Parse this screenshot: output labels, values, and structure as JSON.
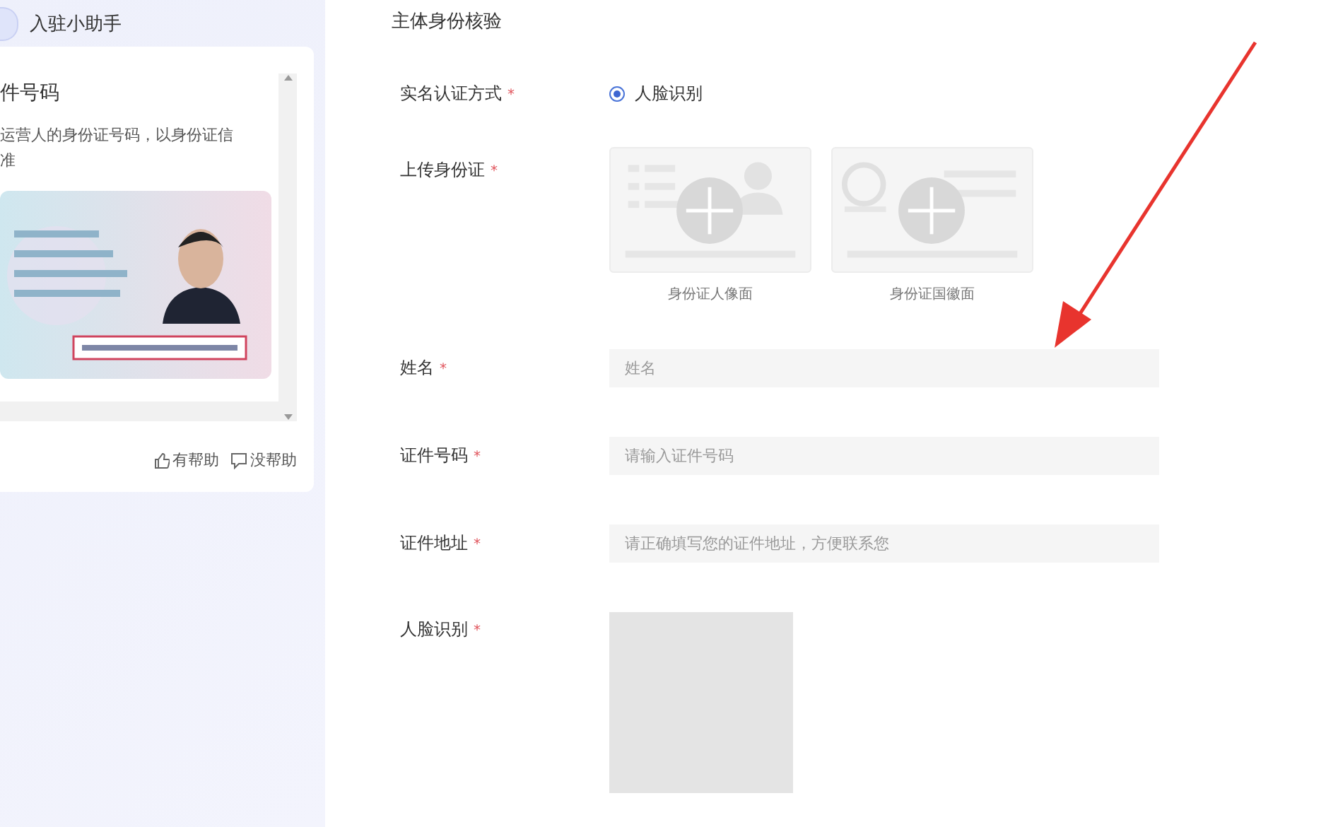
{
  "assistant": {
    "title": "入驻小助手",
    "article_title": "件号码",
    "article_lines": [
      "运营人的身份证号码，以身份证信",
      "准"
    ],
    "feedback": [
      {
        "label": "有帮助",
        "kind": "up"
      },
      {
        "label": "没帮助",
        "kind": "down"
      }
    ]
  },
  "form": {
    "title": "主体身份核验",
    "rows": [
      {
        "kind": "radio",
        "label": "实名认证方式",
        "required_mark": "*",
        "options": [
          {
            "label": "人脸识别",
            "selected": true
          }
        ]
      },
      {
        "kind": "upload",
        "label": "上传身份证",
        "required_mark": "*",
        "slots": [
          {
            "kind": "portrait",
            "caption": "身份证人像面"
          },
          {
            "kind": "emblem",
            "caption": "身份证国徽面"
          }
        ]
      },
      {
        "kind": "text",
        "label": "姓名",
        "required_mark": "*",
        "placeholder": "姓名"
      },
      {
        "kind": "text",
        "label": "证件号码",
        "required_mark": "*",
        "placeholder": "请输入证件号码"
      },
      {
        "kind": "text",
        "label": "证件地址",
        "required_mark": "*",
        "placeholder": "请正确填写您的证件地址，方便联系您"
      },
      {
        "kind": "face",
        "label": "人脸识别",
        "required_mark": "*"
      }
    ]
  }
}
